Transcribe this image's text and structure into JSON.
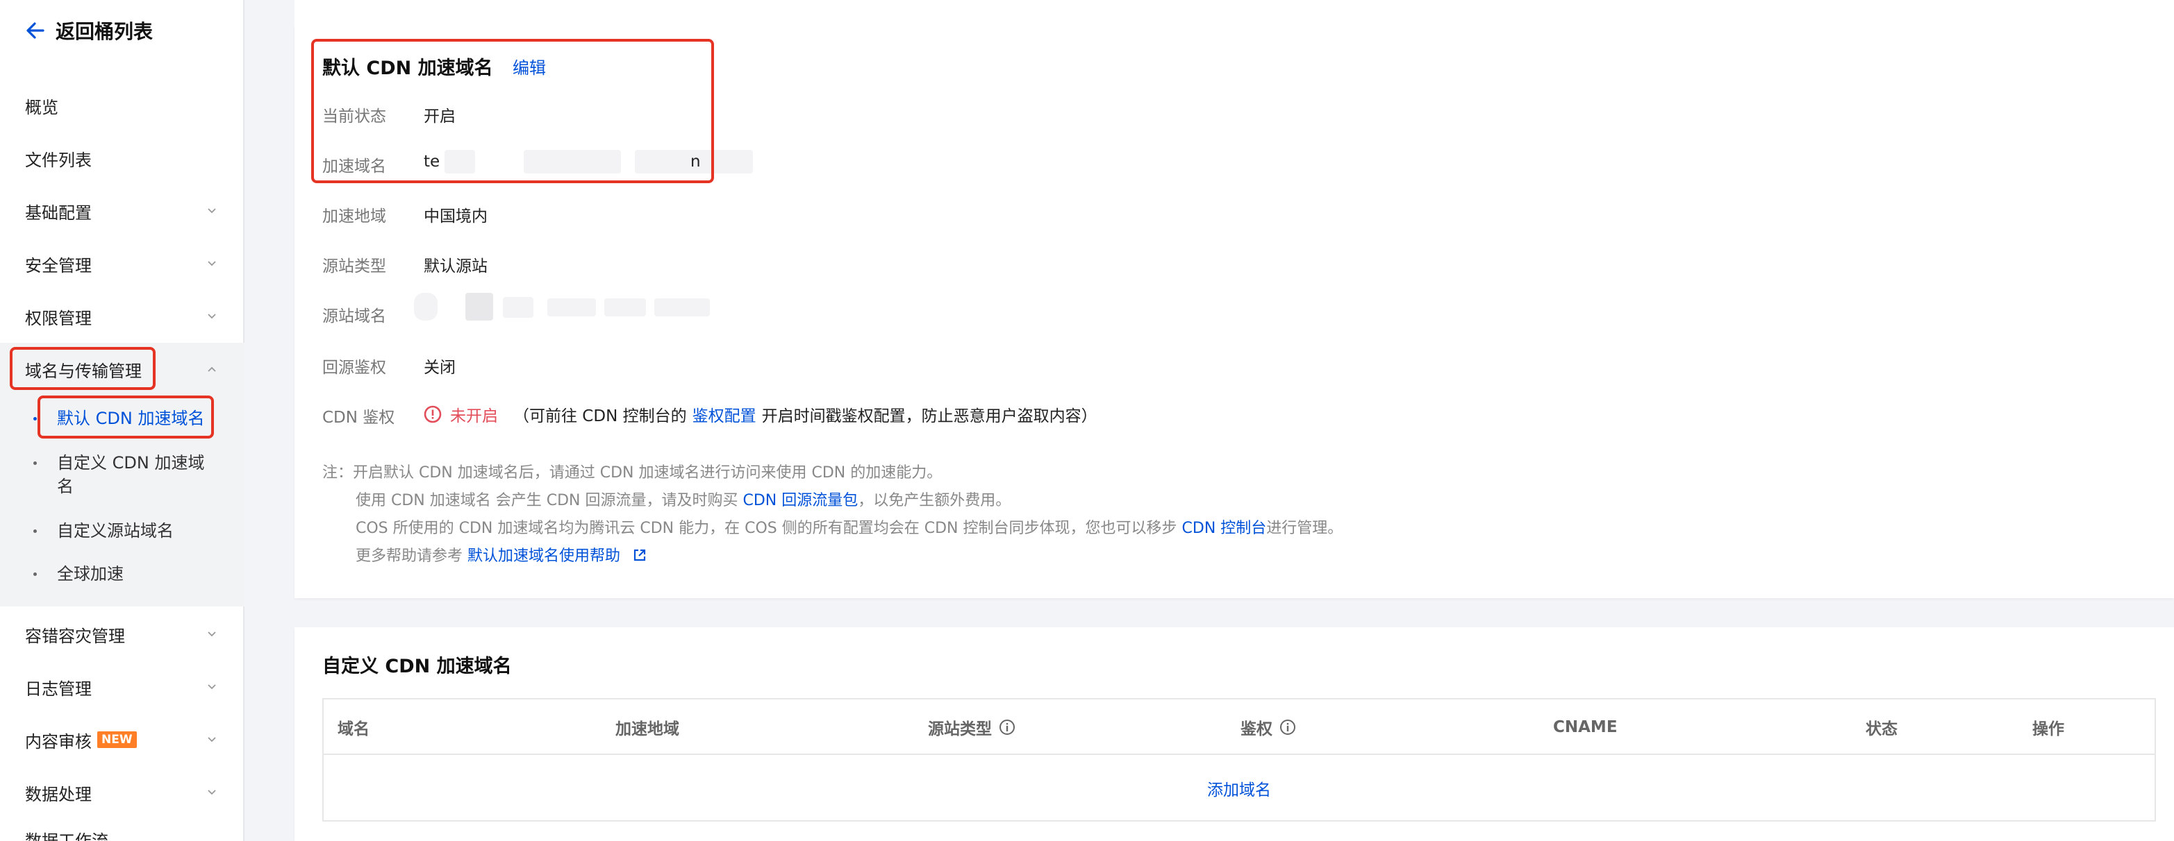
{
  "sidebar": {
    "back_label": "返回桶列表",
    "items": [
      {
        "label": "概览"
      },
      {
        "label": "文件列表"
      },
      {
        "label": "基础配置"
      },
      {
        "label": "安全管理"
      },
      {
        "label": "权限管理"
      },
      {
        "label": "域名与传输管理"
      },
      {
        "label": "容错容灾管理"
      },
      {
        "label": "日志管理"
      },
      {
        "label": "内容审核",
        "badge": "NEW"
      },
      {
        "label": "数据处理"
      }
    ],
    "sub_items": [
      {
        "label": "默认 CDN 加速域名"
      },
      {
        "label": "自定义 CDN 加速域"
      },
      {
        "label": "名"
      },
      {
        "label": "自定义源站域名"
      },
      {
        "label": "全球加速"
      }
    ],
    "partial_last": "数据工作流"
  },
  "default_cdn": {
    "title": "默认 CDN 加速域名",
    "edit_label": "编辑",
    "rows": [
      {
        "label": "当前状态",
        "value": "开启"
      },
      {
        "label": "加速域名",
        "value": "te"
      },
      {
        "label": "加速地域",
        "value": "中国境内"
      },
      {
        "label": "源站类型",
        "value": "默认源站"
      },
      {
        "label": "源站域名",
        "value": ""
      },
      {
        "label": "回源鉴权",
        "value": "关闭"
      },
      {
        "label": "CDN 鉴权",
        "value": ""
      }
    ],
    "domain_tail": "n",
    "auth": {
      "status": "未开启",
      "hint_prefix": "（可前往 CDN 控制台的",
      "hint_link": "鉴权配置",
      "hint_suffix": "开启时间戳鉴权配置，防止恶意用户盗取内容）"
    },
    "notes": {
      "line1": "注：开启默认 CDN 加速域名后，请通过 CDN 加速域名进行访问来使用 CDN 的加速能力。",
      "line2_prefix": "使用 CDN 加速域名 会产生 CDN 回源流量，请及时购买",
      "line2_link": "CDN 回源流量包",
      "line2_suffix": "，以免产生额外费用。",
      "line3_prefix": "COS 所使用的 CDN 加速域名均为腾讯云 CDN 能力，在 COS 侧的所有配置均会在 CDN 控制台同步体现，您也可以移步",
      "line3_link": "CDN 控制台",
      "line3_suffix": "进行管理。",
      "line4_prefix": "更多帮助请参考",
      "line4_link": "默认加速域名使用帮助"
    }
  },
  "custom_cdn": {
    "title": "自定义 CDN 加速域名",
    "columns": [
      "域名",
      "加速地域",
      "源站类型",
      "鉴权",
      "CNAME",
      "状态",
      "操作"
    ],
    "add_label": "添加域名"
  },
  "colors": {
    "accent": "#0052d9",
    "highlight_box": "#e53424",
    "warning": "#e34d59",
    "badge": "#ff7e26"
  }
}
